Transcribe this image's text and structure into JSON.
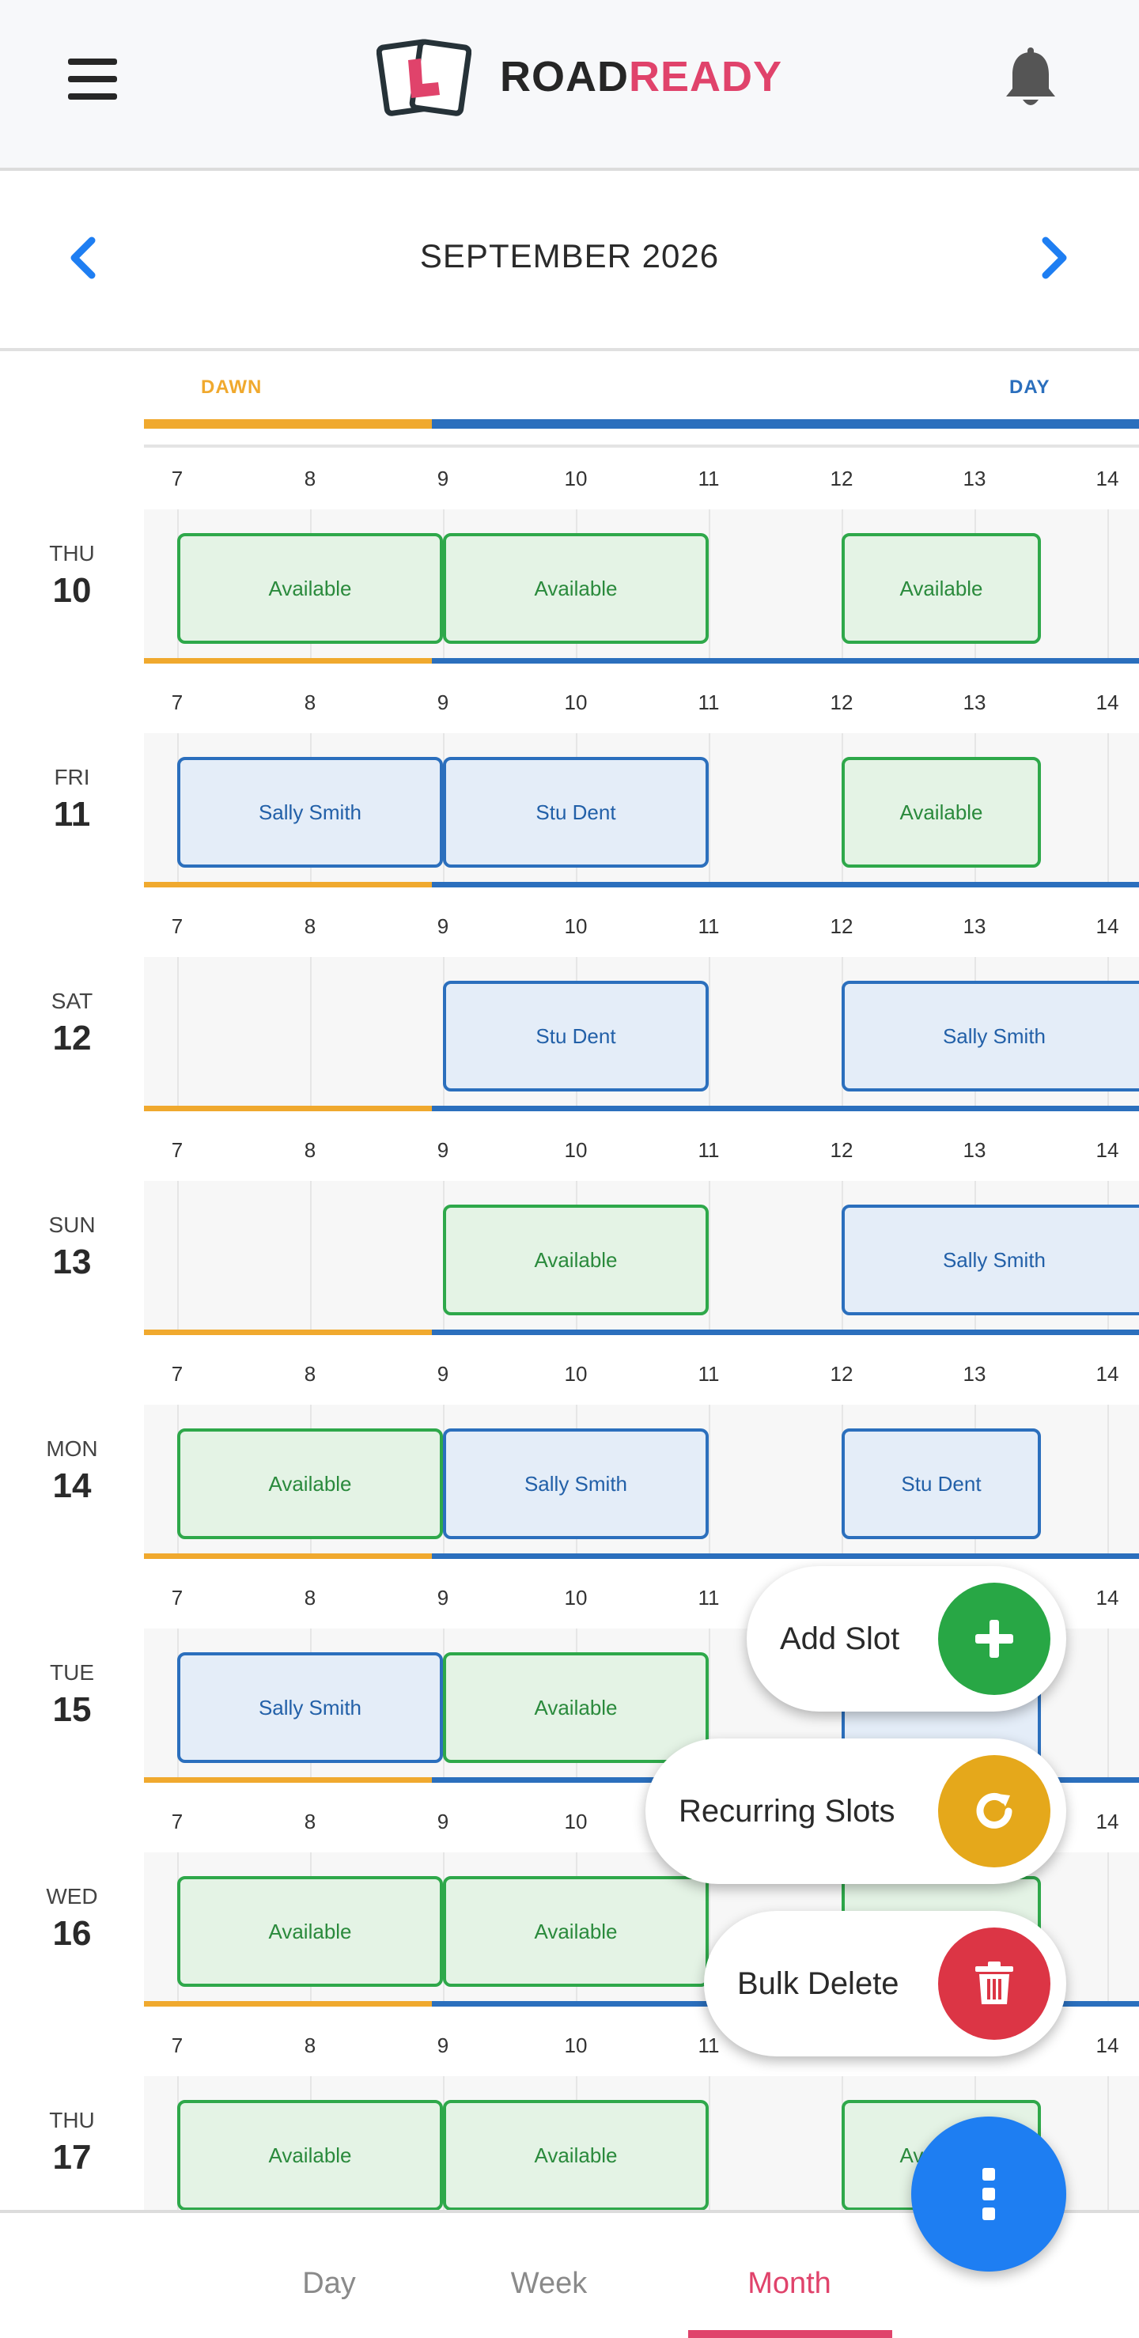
{
  "header": {
    "brand_part1": "ROAD",
    "brand_part2": "READY"
  },
  "calendar": {
    "month_title": "SEPTEMBER 2026",
    "daylight_labels": {
      "dawn": "DAWN",
      "day": "DAY"
    },
    "hour_ticks": [
      "7",
      "8",
      "9",
      "10",
      "11",
      "12",
      "13",
      "14"
    ],
    "days": [
      {
        "dow": "THU",
        "date": "10",
        "slots": [
          {
            "label": "Available",
            "kind": "avail",
            "start": 7,
            "end": 9
          },
          {
            "label": "Available",
            "kind": "avail",
            "start": 9,
            "end": 11
          },
          {
            "label": "Available",
            "kind": "avail",
            "start": 12,
            "end": 13.5
          }
        ]
      },
      {
        "dow": "FRI",
        "date": "11",
        "slots": [
          {
            "label": "Sally Smith",
            "kind": "booked",
            "start": 7,
            "end": 9
          },
          {
            "label": "Stu Dent",
            "kind": "booked",
            "start": 9,
            "end": 11
          },
          {
            "label": "Available",
            "kind": "avail",
            "start": 12,
            "end": 13.5
          }
        ]
      },
      {
        "dow": "SAT",
        "date": "12",
        "slots": [
          {
            "label": "Stu Dent",
            "kind": "booked",
            "start": 9,
            "end": 11
          },
          {
            "label": "Sally Smith",
            "kind": "booked",
            "start": 12,
            "end": 15
          }
        ]
      },
      {
        "dow": "SUN",
        "date": "13",
        "slots": [
          {
            "label": "Available",
            "kind": "avail",
            "start": 9,
            "end": 11
          },
          {
            "label": "Sally Smith",
            "kind": "booked",
            "start": 12,
            "end": 15
          }
        ]
      },
      {
        "dow": "MON",
        "date": "14",
        "slots": [
          {
            "label": "Available",
            "kind": "avail",
            "start": 7,
            "end": 9
          },
          {
            "label": "Sally Smith",
            "kind": "booked",
            "start": 9,
            "end": 11
          },
          {
            "label": "Stu Dent",
            "kind": "booked",
            "start": 12,
            "end": 13.5
          }
        ]
      },
      {
        "dow": "TUE",
        "date": "15",
        "slots": [
          {
            "label": "Sally Smith",
            "kind": "booked",
            "start": 7,
            "end": 9
          },
          {
            "label": "Available",
            "kind": "avail",
            "start": 9,
            "end": 11
          },
          {
            "label": "",
            "kind": "booked",
            "start": 12,
            "end": 13.5
          }
        ]
      },
      {
        "dow": "WED",
        "date": "16",
        "slots": [
          {
            "label": "Available",
            "kind": "avail",
            "start": 7,
            "end": 9
          },
          {
            "label": "Available",
            "kind": "avail",
            "start": 9,
            "end": 11
          },
          {
            "label": "",
            "kind": "avail",
            "start": 12,
            "end": 13.5
          }
        ]
      },
      {
        "dow": "THU",
        "date": "17",
        "slots": [
          {
            "label": "Available",
            "kind": "avail",
            "start": 7,
            "end": 9
          },
          {
            "label": "Available",
            "kind": "avail",
            "start": 9,
            "end": 11
          },
          {
            "label": "Available",
            "kind": "avail",
            "start": 12,
            "end": 13.5
          }
        ]
      }
    ]
  },
  "fab_menu": {
    "add_slot": "Add Slot",
    "recurring_slots": "Recurring Slots",
    "bulk_delete": "Bulk Delete"
  },
  "bottom_nav": {
    "tabs": [
      "Day",
      "Week",
      "Month"
    ],
    "active": "Month"
  },
  "colors": {
    "brand_pink": "#e0436b",
    "accent_blue": "#1e7ef2",
    "dawn_orange": "#f0a92e",
    "day_blue": "#2b6fbd",
    "available_green": "#2ea84a",
    "add_green": "#28a745",
    "recurring_yellow": "#e5a81b",
    "delete_red": "#dc3545"
  },
  "icons": {
    "menu": "hamburger-icon",
    "notifications": "bell-icon",
    "prev": "chevron-left-icon",
    "next": "chevron-right-icon",
    "add": "plus-icon",
    "recurring": "refresh-icon",
    "delete": "trash-icon",
    "more": "more-vertical-icon"
  }
}
